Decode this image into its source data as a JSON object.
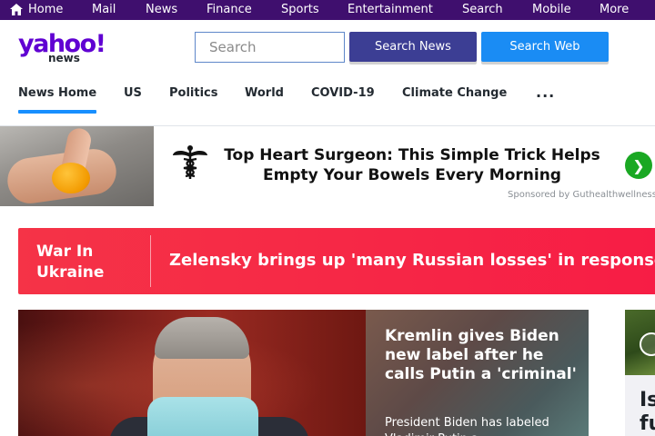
{
  "topnav": {
    "items": [
      {
        "label": "Home",
        "icon": "home-icon"
      },
      {
        "label": "Mail"
      },
      {
        "label": "News"
      },
      {
        "label": "Finance"
      },
      {
        "label": "Sports"
      },
      {
        "label": "Entertainment"
      },
      {
        "label": "Search"
      },
      {
        "label": "Mobile"
      },
      {
        "label": "More"
      }
    ],
    "bg": "#3f0f6e"
  },
  "header": {
    "logo_text": "yahoo!",
    "logo_sub": "news",
    "search_placeholder": "Search",
    "search_news_label": "Search News",
    "search_web_label": "Search Web"
  },
  "tabs": [
    {
      "label": "News Home",
      "active": true
    },
    {
      "label": "US"
    },
    {
      "label": "Politics"
    },
    {
      "label": "World"
    },
    {
      "label": "COVID-19"
    },
    {
      "label": "Climate Change"
    },
    {
      "label": "···"
    }
  ],
  "ad": {
    "headline": "Top Heart Surgeon: This Simple Trick Helps Empty Your Bowels Every Morning",
    "sponsor": "Sponsored by Guthealthwellness"
  },
  "banner": {
    "label": "War In Ukraine",
    "headline": "Zelensky brings up 'many Russian losses' in response"
  },
  "hero": {
    "title": "Kremlin gives Biden new label after he calls Putin a 'criminal'",
    "summary": "President Biden has labeled Vladimir Putin a"
  },
  "side": {
    "text": "Is fu"
  }
}
